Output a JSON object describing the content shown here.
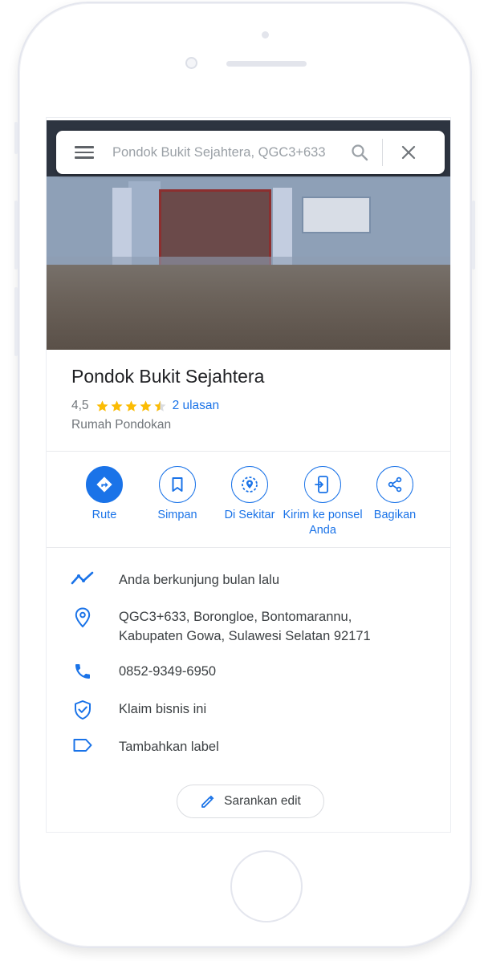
{
  "search": {
    "query": "Pondok Bukit Sejahtera, QGC3+633"
  },
  "place": {
    "name": "Pondok Bukit Sejahtera",
    "rating": "4,5",
    "stars": 4.5,
    "reviews": "2 ulasan",
    "category": "Rumah Pondokan"
  },
  "actions": [
    {
      "label": "Rute",
      "icon": "directions-icon"
    },
    {
      "label": "Simpan",
      "icon": "bookmark-icon"
    },
    {
      "label": "Di Sekitar",
      "icon": "nearby-icon"
    },
    {
      "label": "Kirim ke ponsel Anda",
      "icon": "send-to-phone-icon"
    },
    {
      "label": "Bagikan",
      "icon": "share-icon"
    }
  ],
  "details": {
    "visited": "Anda berkunjung bulan lalu",
    "address": "QGC3+633, Borongloe, Bontomarannu, Kabupaten Gowa, Sulawesi Selatan 92171",
    "phone": "0852-9349-6950",
    "claim": "Klaim bisnis ini",
    "add_label": "Tambahkan label"
  },
  "suggest_edit": "Sarankan edit",
  "colors": {
    "accent": "#1a73e8",
    "star": "#fbbc04",
    "text": "#202124",
    "secondary": "#70757a"
  }
}
